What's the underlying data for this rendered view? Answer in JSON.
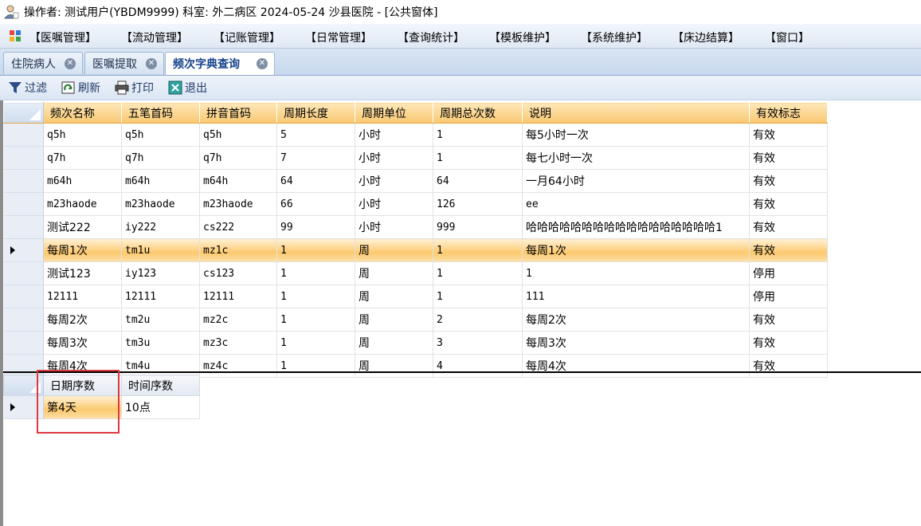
{
  "window": {
    "title": "操作者: 测试用户(YBDM9999)  科室: 外二病区  2024-05-24  沙县医院 - [公共窗体]"
  },
  "menu": {
    "items": [
      "【医嘱管理】",
      "【流动管理】",
      "【记账管理】",
      "【日常管理】",
      "【查询统计】",
      "【模板维护】",
      "【系统维护】",
      "【床边结算】",
      "【窗口】"
    ]
  },
  "tabs": [
    {
      "label": "住院病人",
      "active": false
    },
    {
      "label": "医嘱提取",
      "active": false
    },
    {
      "label": "频次字典查询",
      "active": true
    }
  ],
  "toolbar": {
    "filter": "过滤",
    "refresh": "刷新",
    "print": "打印",
    "exit": "退出"
  },
  "main_grid": {
    "columns": [
      "频次名称",
      "五笔首码",
      "拼音首码",
      "周期长度",
      "周期单位",
      "周期总次数",
      "说明",
      "有效标志"
    ],
    "selected_row": 5,
    "rows": [
      [
        "q5h",
        "q5h",
        "q5h",
        "5",
        "小时",
        "1",
        "每5小时一次",
        "有效"
      ],
      [
        "q7h",
        "q7h",
        "q7h",
        "7",
        "小时",
        "1",
        "每七小时一次",
        "有效"
      ],
      [
        "m64h",
        "m64h",
        "m64h",
        "64",
        "小时",
        "64",
        "一月64小时",
        "有效"
      ],
      [
        "m23haode",
        "m23haode",
        "m23haode",
        "66",
        "小时",
        "126",
        "ee",
        "有效"
      ],
      [
        "测试222",
        "iy222",
        "cs222",
        "99",
        "小时",
        "999",
        "哈哈哈哈哈哈哈哈哈哈哈哈哈哈哈哈哈1",
        "有效"
      ],
      [
        "每周1次",
        "tm1u",
        "mz1c",
        "1",
        "周",
        "1",
        "每周1次",
        "有效"
      ],
      [
        "测试123",
        "iy123",
        "cs123",
        "1",
        "周",
        "1",
        "1",
        "停用"
      ],
      [
        "12111",
        "12111",
        "12111",
        "1",
        "周",
        "1",
        "111",
        "停用"
      ],
      [
        "每周2次",
        "tm2u",
        "mz2c",
        "1",
        "周",
        "2",
        "每周2次",
        "有效"
      ],
      [
        "每周3次",
        "tm3u",
        "mz3c",
        "1",
        "周",
        "3",
        "每周3次",
        "有效"
      ],
      [
        "每周4次",
        "tm4u",
        "mz4c",
        "1",
        "周",
        "4",
        "每周4次",
        "有效"
      ]
    ]
  },
  "detail_grid": {
    "columns": [
      "日期序数",
      "时间序数"
    ],
    "rows": [
      [
        "第4天",
        "10点"
      ]
    ]
  }
}
